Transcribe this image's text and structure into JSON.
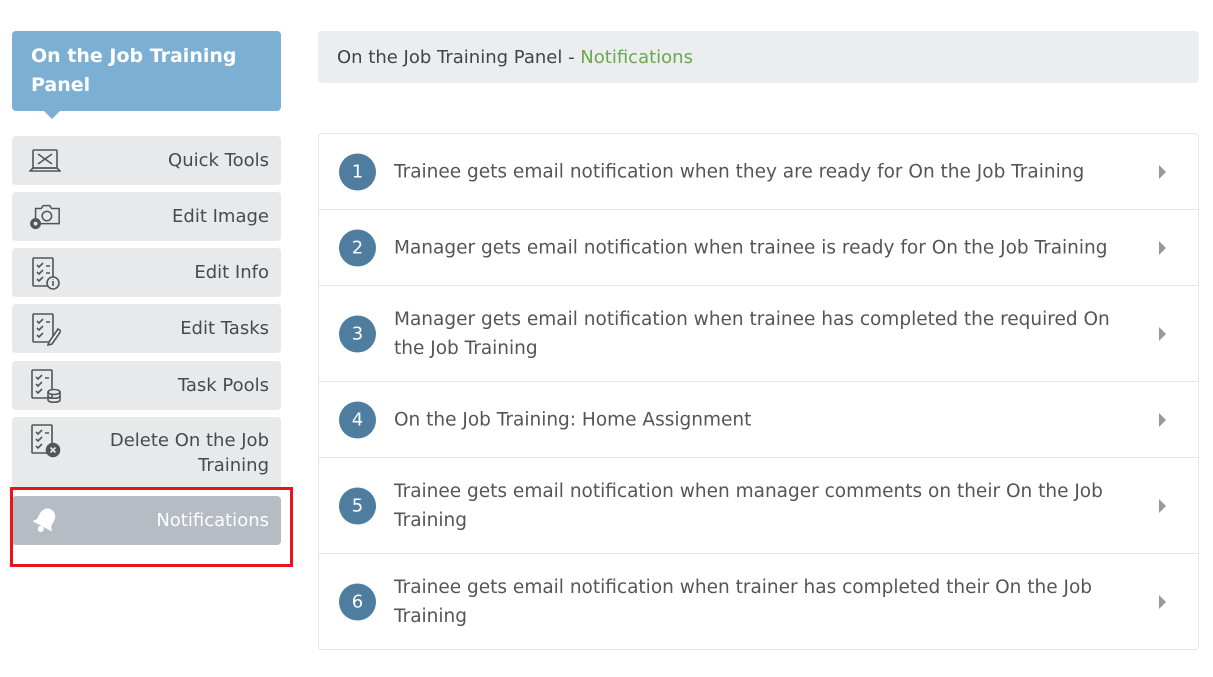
{
  "sidebar": {
    "title": "On the Job Training Panel",
    "items": [
      {
        "label": "Quick Tools",
        "icon": "quick-tools-icon"
      },
      {
        "label": "Edit Image",
        "icon": "edit-image-icon"
      },
      {
        "label": "Edit Info",
        "icon": "edit-info-icon"
      },
      {
        "label": "Edit Tasks",
        "icon": "edit-tasks-icon"
      },
      {
        "label": "Task Pools",
        "icon": "task-pools-icon"
      },
      {
        "label": "Delete On the Job Training",
        "icon": "delete-icon"
      },
      {
        "label": "Notifications",
        "icon": "bell-icon",
        "active": true
      }
    ]
  },
  "breadcrumb": {
    "parent": "On the Job Training Panel",
    "separator": " - ",
    "current": "Notifications"
  },
  "notifications": [
    {
      "number": "1",
      "text": "Trainee gets email notification when they are ready for On the Job Training"
    },
    {
      "number": "2",
      "text": "Manager gets email notification when trainee is ready for On the Job Training"
    },
    {
      "number": "3",
      "text": "Manager gets email notification when trainee has completed the required On the Job Training"
    },
    {
      "number": "4",
      "text": "On the Job Training: Home Assignment"
    },
    {
      "number": "5",
      "text": "Trainee gets email notification when manager comments on their On the Job Training"
    },
    {
      "number": "6",
      "text": "Trainee gets email notification when trainer has completed their On the Job Training"
    }
  ],
  "colors": {
    "panel_header": "#7bafd4",
    "number_badge": "#4e7da0",
    "breadcrumb_current": "#6aa84f",
    "active_item": "#b6bcc3",
    "highlight": "#e8141b"
  }
}
